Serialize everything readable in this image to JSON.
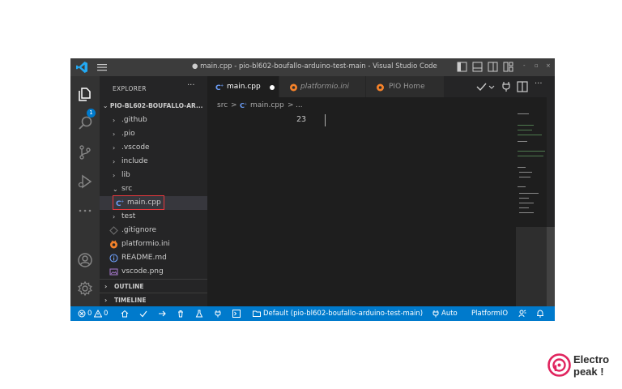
{
  "window": {
    "title": "● main.cpp - pio-bl602-boufallo-arduino-test-main - Visual Studio Code",
    "controls": [
      "-",
      "▫",
      "×"
    ]
  },
  "activity_bar": {
    "explorer_badge": "1"
  },
  "sidebar": {
    "header": "EXPLORER",
    "more": "···",
    "root": "PIO-BL602-BOUFALLO-AR...",
    "items": [
      {
        "label": ".github",
        "chevron": "›"
      },
      {
        "label": ".pio",
        "chevron": "›"
      },
      {
        "label": ".vscode",
        "chevron": "›"
      },
      {
        "label": "include",
        "chevron": "›"
      },
      {
        "label": "lib",
        "chevron": "›"
      },
      {
        "label": "src",
        "chevron": "⌄"
      },
      {
        "label": "main.cpp",
        "icon": "cpp-file-icon"
      },
      {
        "label": "test",
        "chevron": "›"
      },
      {
        "label": ".gitignore",
        "icon": "git-file-icon"
      },
      {
        "label": "platformio.ini",
        "icon": "platformio-icon"
      },
      {
        "label": "README.md",
        "icon": "info-icon"
      },
      {
        "label": "vscode.png",
        "icon": "image-file-icon"
      }
    ],
    "sections": [
      {
        "label": "OUTLINE",
        "chevron": "›"
      },
      {
        "label": "TIMELINE",
        "chevron": "›"
      }
    ]
  },
  "tabs": [
    {
      "label": "main.cpp",
      "active": true,
      "modified": true
    },
    {
      "label": "platformio.ini",
      "active": false
    },
    {
      "label": "PIO Home",
      "active": false
    }
  ],
  "tab_actions": {
    "more": "···"
  },
  "breadcrumb": {
    "parts": [
      "src",
      ">",
      "main.cpp",
      ">",
      "..."
    ]
  },
  "editor": {
    "line_number": "23"
  },
  "statusbar": {
    "errors": "0",
    "warnings": "0",
    "env": "Default (pio-bl602-boufallo-arduino-test-main)",
    "auto": "Auto",
    "platformio": "PlatformIO"
  },
  "brand": {
    "line1": "Electro",
    "line2": "peak !"
  },
  "colors": {
    "accent": "#007acc",
    "selection_box": "#e8383d",
    "brand": "#e0245e"
  }
}
